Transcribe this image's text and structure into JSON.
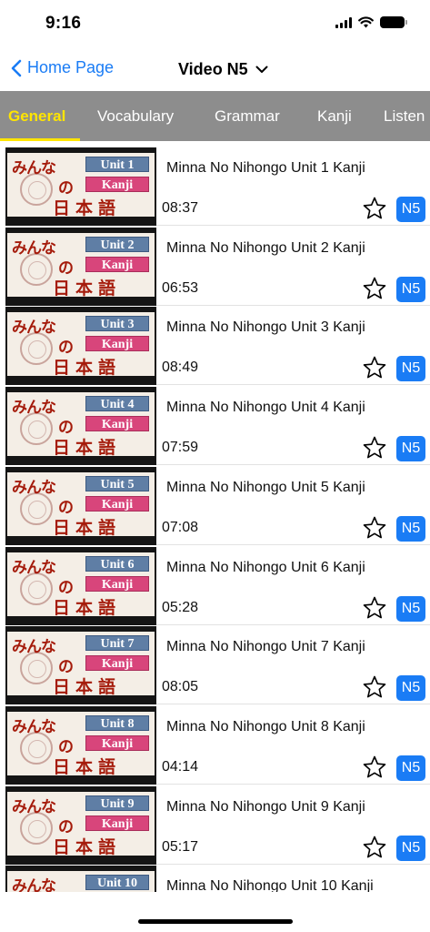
{
  "status_bar": {
    "time": "9:16"
  },
  "nav": {
    "back_label": "Home Page",
    "title": "Video N5"
  },
  "tabs": [
    {
      "label": "General",
      "active": true
    },
    {
      "label": "Vocabulary",
      "active": false
    },
    {
      "label": "Grammar",
      "active": false
    },
    {
      "label": "Kanji",
      "active": false
    },
    {
      "label": "Listen",
      "active": false
    }
  ],
  "thumbnail_text": {
    "minna": "みんな",
    "no": "の",
    "nihongo": "日本語",
    "kanji_badge": "Kanji"
  },
  "videos": [
    {
      "unit_badge": "Unit 1",
      "title": "Minna No Nihongo Unit 1 Kanji",
      "duration": "08:37",
      "level": "N5"
    },
    {
      "unit_badge": "Unit 2",
      "title": "Minna No Nihongo Unit 2 Kanji",
      "duration": "06:53",
      "level": "N5"
    },
    {
      "unit_badge": "Unit 3",
      "title": "Minna No Nihongo Unit 3 Kanji",
      "duration": "08:49",
      "level": "N5"
    },
    {
      "unit_badge": "Unit 4",
      "title": "Minna No Nihongo Unit 4 Kanji",
      "duration": "07:59",
      "level": "N5"
    },
    {
      "unit_badge": "Unit 5",
      "title": "Minna No Nihongo Unit 5 Kanji",
      "duration": "07:08",
      "level": "N5"
    },
    {
      "unit_badge": "Unit 6",
      "title": "Minna No Nihongo Unit 6 Kanji",
      "duration": "05:28",
      "level": "N5"
    },
    {
      "unit_badge": "Unit 7",
      "title": "Minna No Nihongo Unit 7 Kanji",
      "duration": "08:05",
      "level": "N5"
    },
    {
      "unit_badge": "Unit 8",
      "title": "Minna No Nihongo Unit 8 Kanji",
      "duration": "04:14",
      "level": "N5"
    },
    {
      "unit_badge": "Unit 9",
      "title": "Minna No Nihongo Unit 9 Kanji",
      "duration": "05:17",
      "level": "N5"
    },
    {
      "unit_badge": "Unit 10",
      "title": "Minna No Nihongo Unit 10 Kanji",
      "duration": "",
      "level": ""
    }
  ],
  "colors": {
    "accent": "#1a7cf5",
    "tab_bar": "#8d8d8d",
    "active_tab": "#ffe500",
    "thumb_red": "#a51b0b"
  },
  "icons": {
    "back": "chevron-left-icon",
    "title_dropdown": "chevron-down-icon",
    "favorite": "star-outline-icon"
  }
}
